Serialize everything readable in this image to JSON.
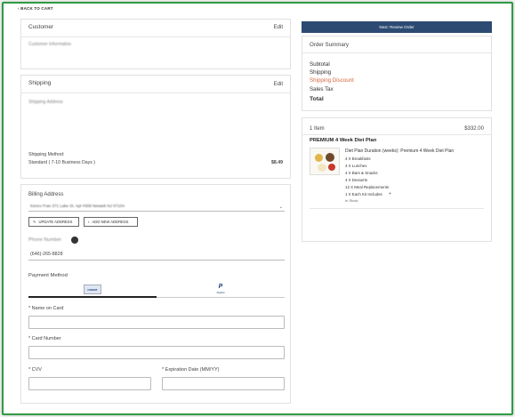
{
  "nav": {
    "back_label": "‹ BACK TO CART"
  },
  "customer": {
    "title": "Customer",
    "edit_label": "Edit",
    "info_label": "Customer Information"
  },
  "shipping": {
    "title": "Shipping",
    "edit_label": "Edit",
    "address_label": "Shipping Address",
    "method_label": "Shipping Method:",
    "method_value": "Standard ( 7-10 Business Days )",
    "method_price": "$8.49"
  },
  "billing": {
    "title": "Billing Address",
    "selected_address": "Kenzo Fran 371 Lake St. Apt #308 Newark NJ 07104",
    "update_label": "UPDATE ADDRESS",
    "add_label": "ADD NEW ADDRESS",
    "phone_label": "Phone Number",
    "phone_value": "(646)-265-8828"
  },
  "payment": {
    "title": "Payment Method",
    "tabs": [
      {
        "label": "CREDIT"
      },
      {
        "label": "PayPal"
      }
    ],
    "name_label": "* Name on Card",
    "card_label": "* Card Number",
    "cvv_label": "* CVV",
    "exp_label": "* Expiration Date (MM/YY)"
  },
  "review_button": "Next: Review Order",
  "order_summary": {
    "title": "Order Summary",
    "rows": [
      {
        "label": "Subtotal",
        "color": "#333"
      },
      {
        "label": "Shipping",
        "color": "#333"
      },
      {
        "label": "Shipping Discount",
        "color": "#d8663e"
      },
      {
        "label": "Sales Tax",
        "color": "#333"
      },
      {
        "label": "Total",
        "color": "#222"
      }
    ]
  },
  "cart": {
    "count": "1 Item",
    "price": "$332.00",
    "product_name": "PREMIUM 4 Week Diet Plan",
    "option": "Diet Plan Duration (weeks): Premium 4 Week Diet Plan",
    "lines": [
      "4 X Breakfasts",
      "4 X Lunches",
      "4 X Bars & Snacks",
      "4 X Desserts",
      "12 X Meal Replacements",
      "1 X Each Kit Includes"
    ],
    "stock": "In Stock"
  },
  "colors": {
    "accent": "#2c4a72",
    "frame": "#2f9a43",
    "discount": "#d8663e"
  }
}
